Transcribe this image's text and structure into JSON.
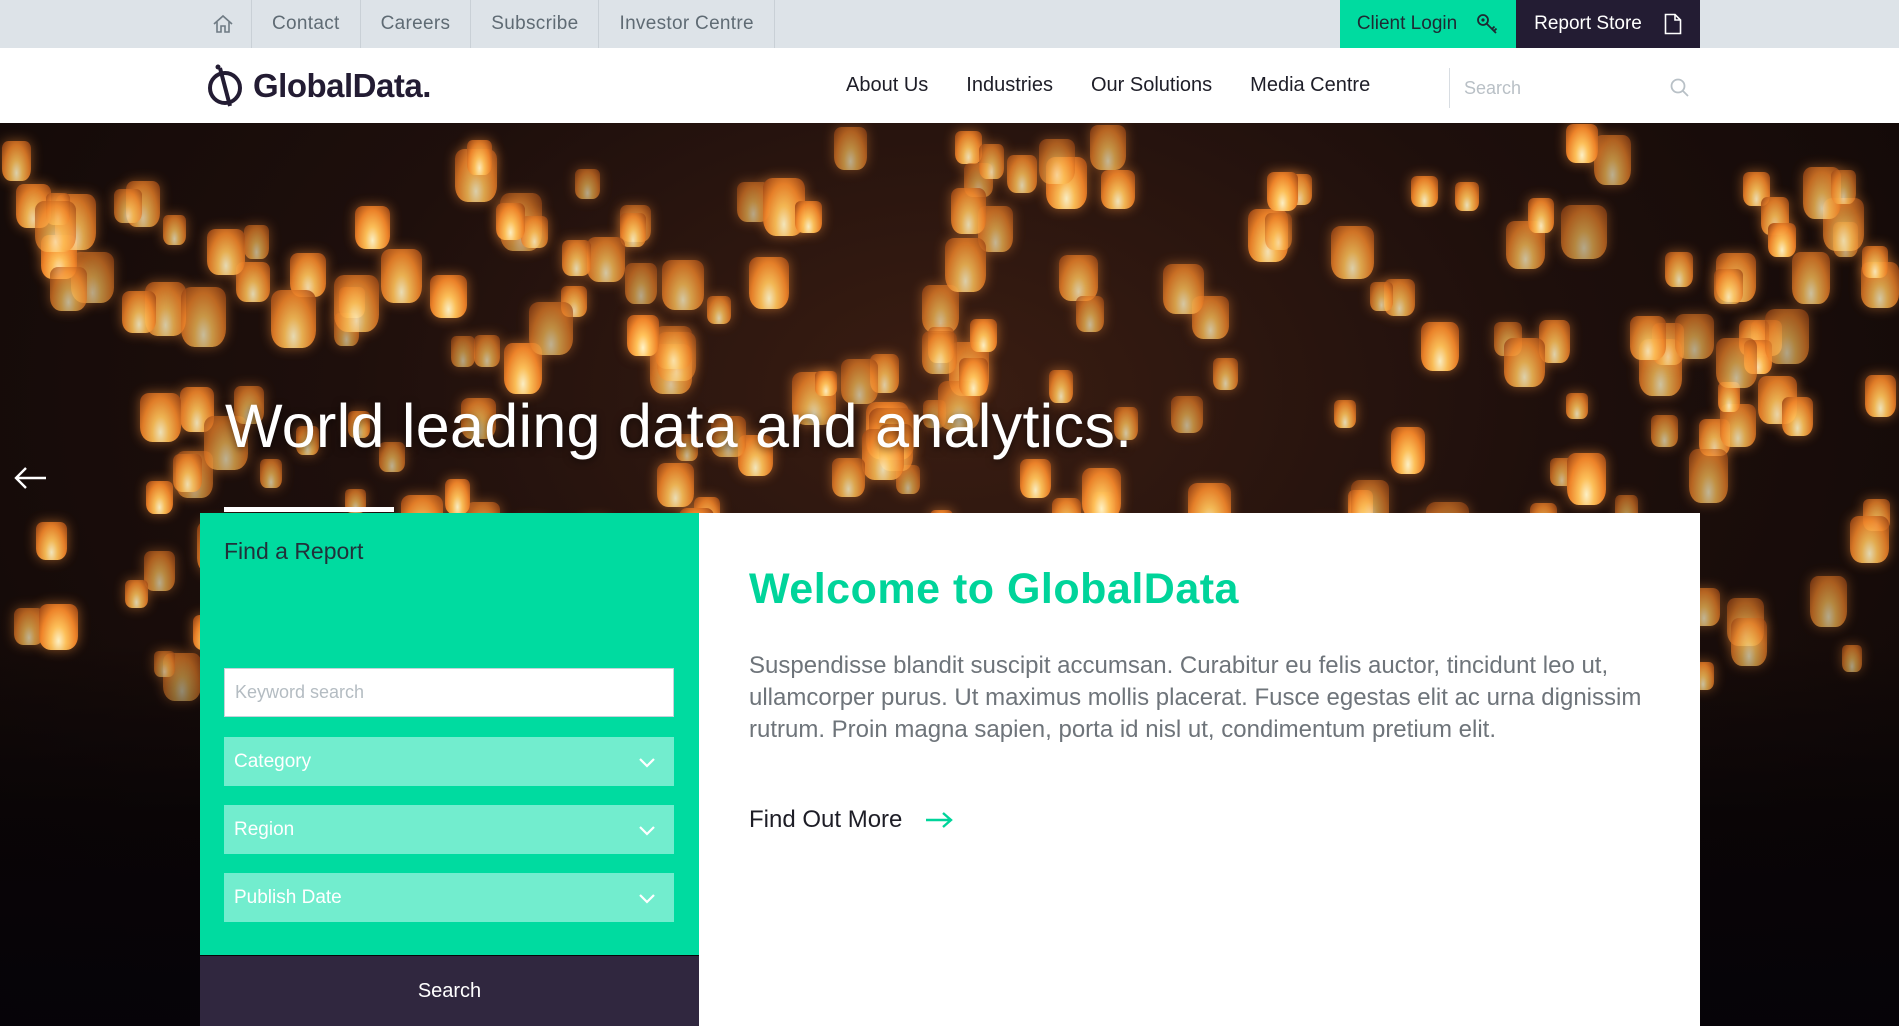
{
  "utility_bar": {
    "links": [
      "Contact",
      "Careers",
      "Subscribe",
      "Investor Centre"
    ],
    "client_login": "Client Login",
    "report_store": "Report Store"
  },
  "header": {
    "logo_text": "GlobalData.",
    "nav": [
      "About Us",
      "Industries",
      "Our Solutions",
      "Media Centre"
    ],
    "search_placeholder": "Search"
  },
  "hero": {
    "title": "World leading data and analytics."
  },
  "find_report": {
    "title": "Find a Report",
    "keyword_placeholder": "Keyword search",
    "selects": [
      "Category",
      "Region",
      "Publish Date"
    ],
    "search_button": "Search"
  },
  "welcome": {
    "title": "Welcome to GlobalData",
    "body": "Suspendisse blandit suscipit accumsan. Curabitur eu felis auctor, tincidunt leo ut, ullamcorper purus. Ut maximus mollis placerat. Fusce egestas elit ac urna dignissim rutrum. Proin magna sapien, porta id nisl ut, condimentum pretium elit.",
    "cta": "Find Out More"
  },
  "colors": {
    "accent_green": "#00dba0",
    "dark_navy": "#231c33",
    "utility_bg": "#dde3e8"
  }
}
